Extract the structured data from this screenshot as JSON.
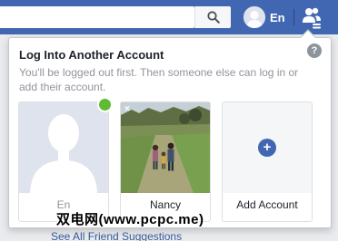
{
  "topbar": {
    "search": {
      "value": "",
      "placeholder": ""
    },
    "profile_name": "En"
  },
  "dropdown": {
    "title": "Log Into Another Account",
    "description": "You'll be logged out first. Then someone else can log in or add their account.",
    "help": "?",
    "accounts": [
      {
        "label": "En"
      },
      {
        "label": "Nancy"
      },
      {
        "label": "Add Account"
      }
    ],
    "add_symbol": "+",
    "remove_symbol": "×"
  },
  "footer": {
    "friend_suggestions": "See All Friend Suggestions"
  },
  "watermark": "双电网(www.pcpc.me)",
  "colors": {
    "brand_blue": "#4267b2",
    "online_green": "#5fbb32",
    "link": "#365899"
  }
}
